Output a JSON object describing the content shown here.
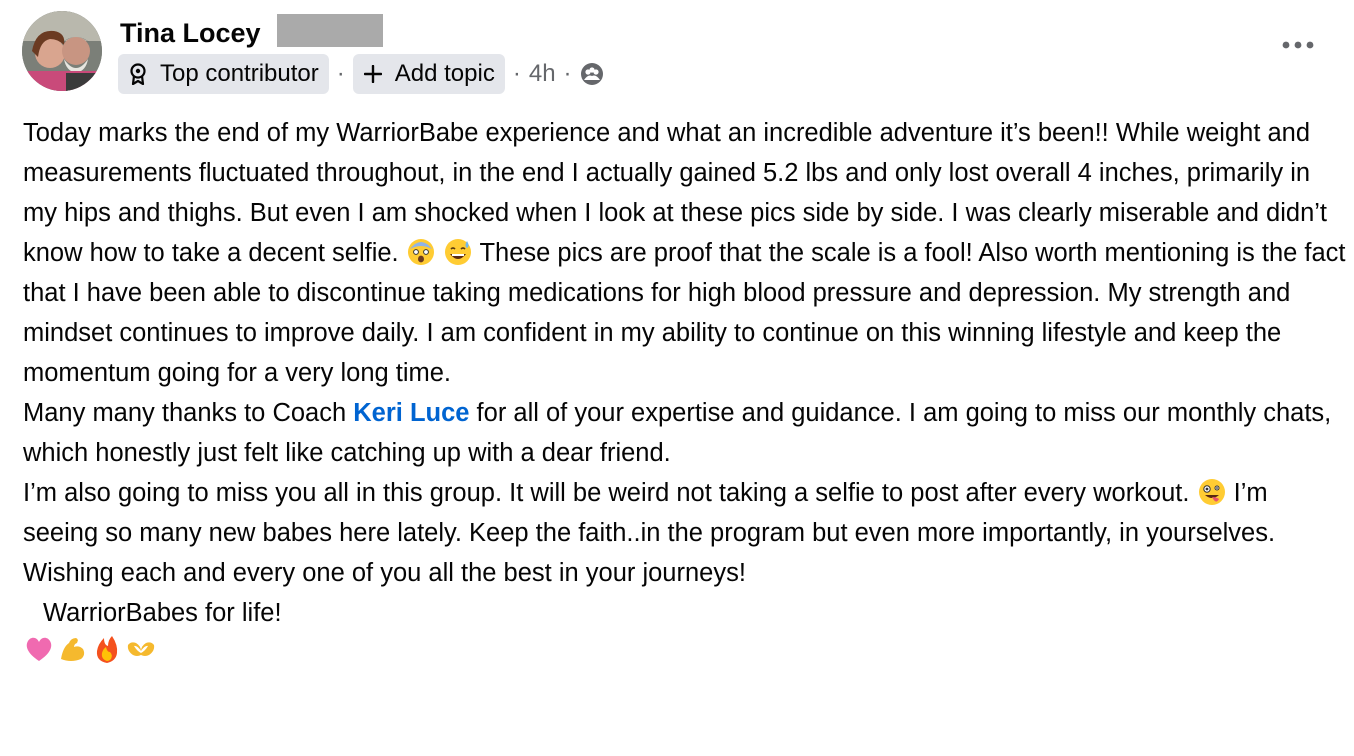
{
  "author": {
    "name": "Tina Locey"
  },
  "badges": {
    "top_contributor_label": "Top contributor",
    "add_topic_label": "Add topic",
    "separator": "·",
    "time": "4h"
  },
  "post": {
    "para1": "Today marks the end of my WarriorBabe experience and what an incredible adventure it’s been!! While weight and measurements fluctuated throughout, in the end I actually gained 5.2 lbs and only lost overall 4 inches, primarily in my hips and thighs. But even I am shocked when I look at these pics side by side. I was clearly miserable and didn’t know how to take a decent selfie.",
    "para1b": "These pics are proof that the scale is a fool! Also worth mentioning is the fact that I have been able to discontinue taking medications for high blood pressure and depression. My strength and mindset continues to improve daily. I am confident in my ability to continue on this winning lifestyle and keep the momentum going for a very long time.",
    "para2_start": "Many many thanks to Coach ",
    "mention": "Keri Luce",
    "para2_end": " for all of your expertise and guidance. I am going to miss our monthly chats, which honestly just felt like catching up with a dear friend.",
    "para3_start": "I’m also going to miss you all in this group. It will be weird not taking a selfie to post after every workout.",
    "para3_end": "I’m seeing so many new babes here lately. Keep the faith..in the program but even more importantly, in yourselves. Wishing each and every one of you all the best in your journeys!",
    "para4": "WarriorBabes for life!"
  },
  "icons": {
    "top_contributor": "contributor-badge-icon",
    "add_topic": "plus-icon",
    "privacy": "group-audience-icon",
    "more": "more-options-icon",
    "emoji_1": "fearful-face-emoji",
    "emoji_2": "grinning-sweat-emoji",
    "emoji_3": "zany-face-emoji",
    "emoji_row": [
      "pink-heart-emoji",
      "flexed-biceps-emoji",
      "fire-emoji",
      "heart-hands-emoji"
    ]
  },
  "colors": {
    "mention": "#0064d1",
    "meta": "#65676b",
    "chip_bg": "#e4e6eb",
    "text": "#050505"
  }
}
